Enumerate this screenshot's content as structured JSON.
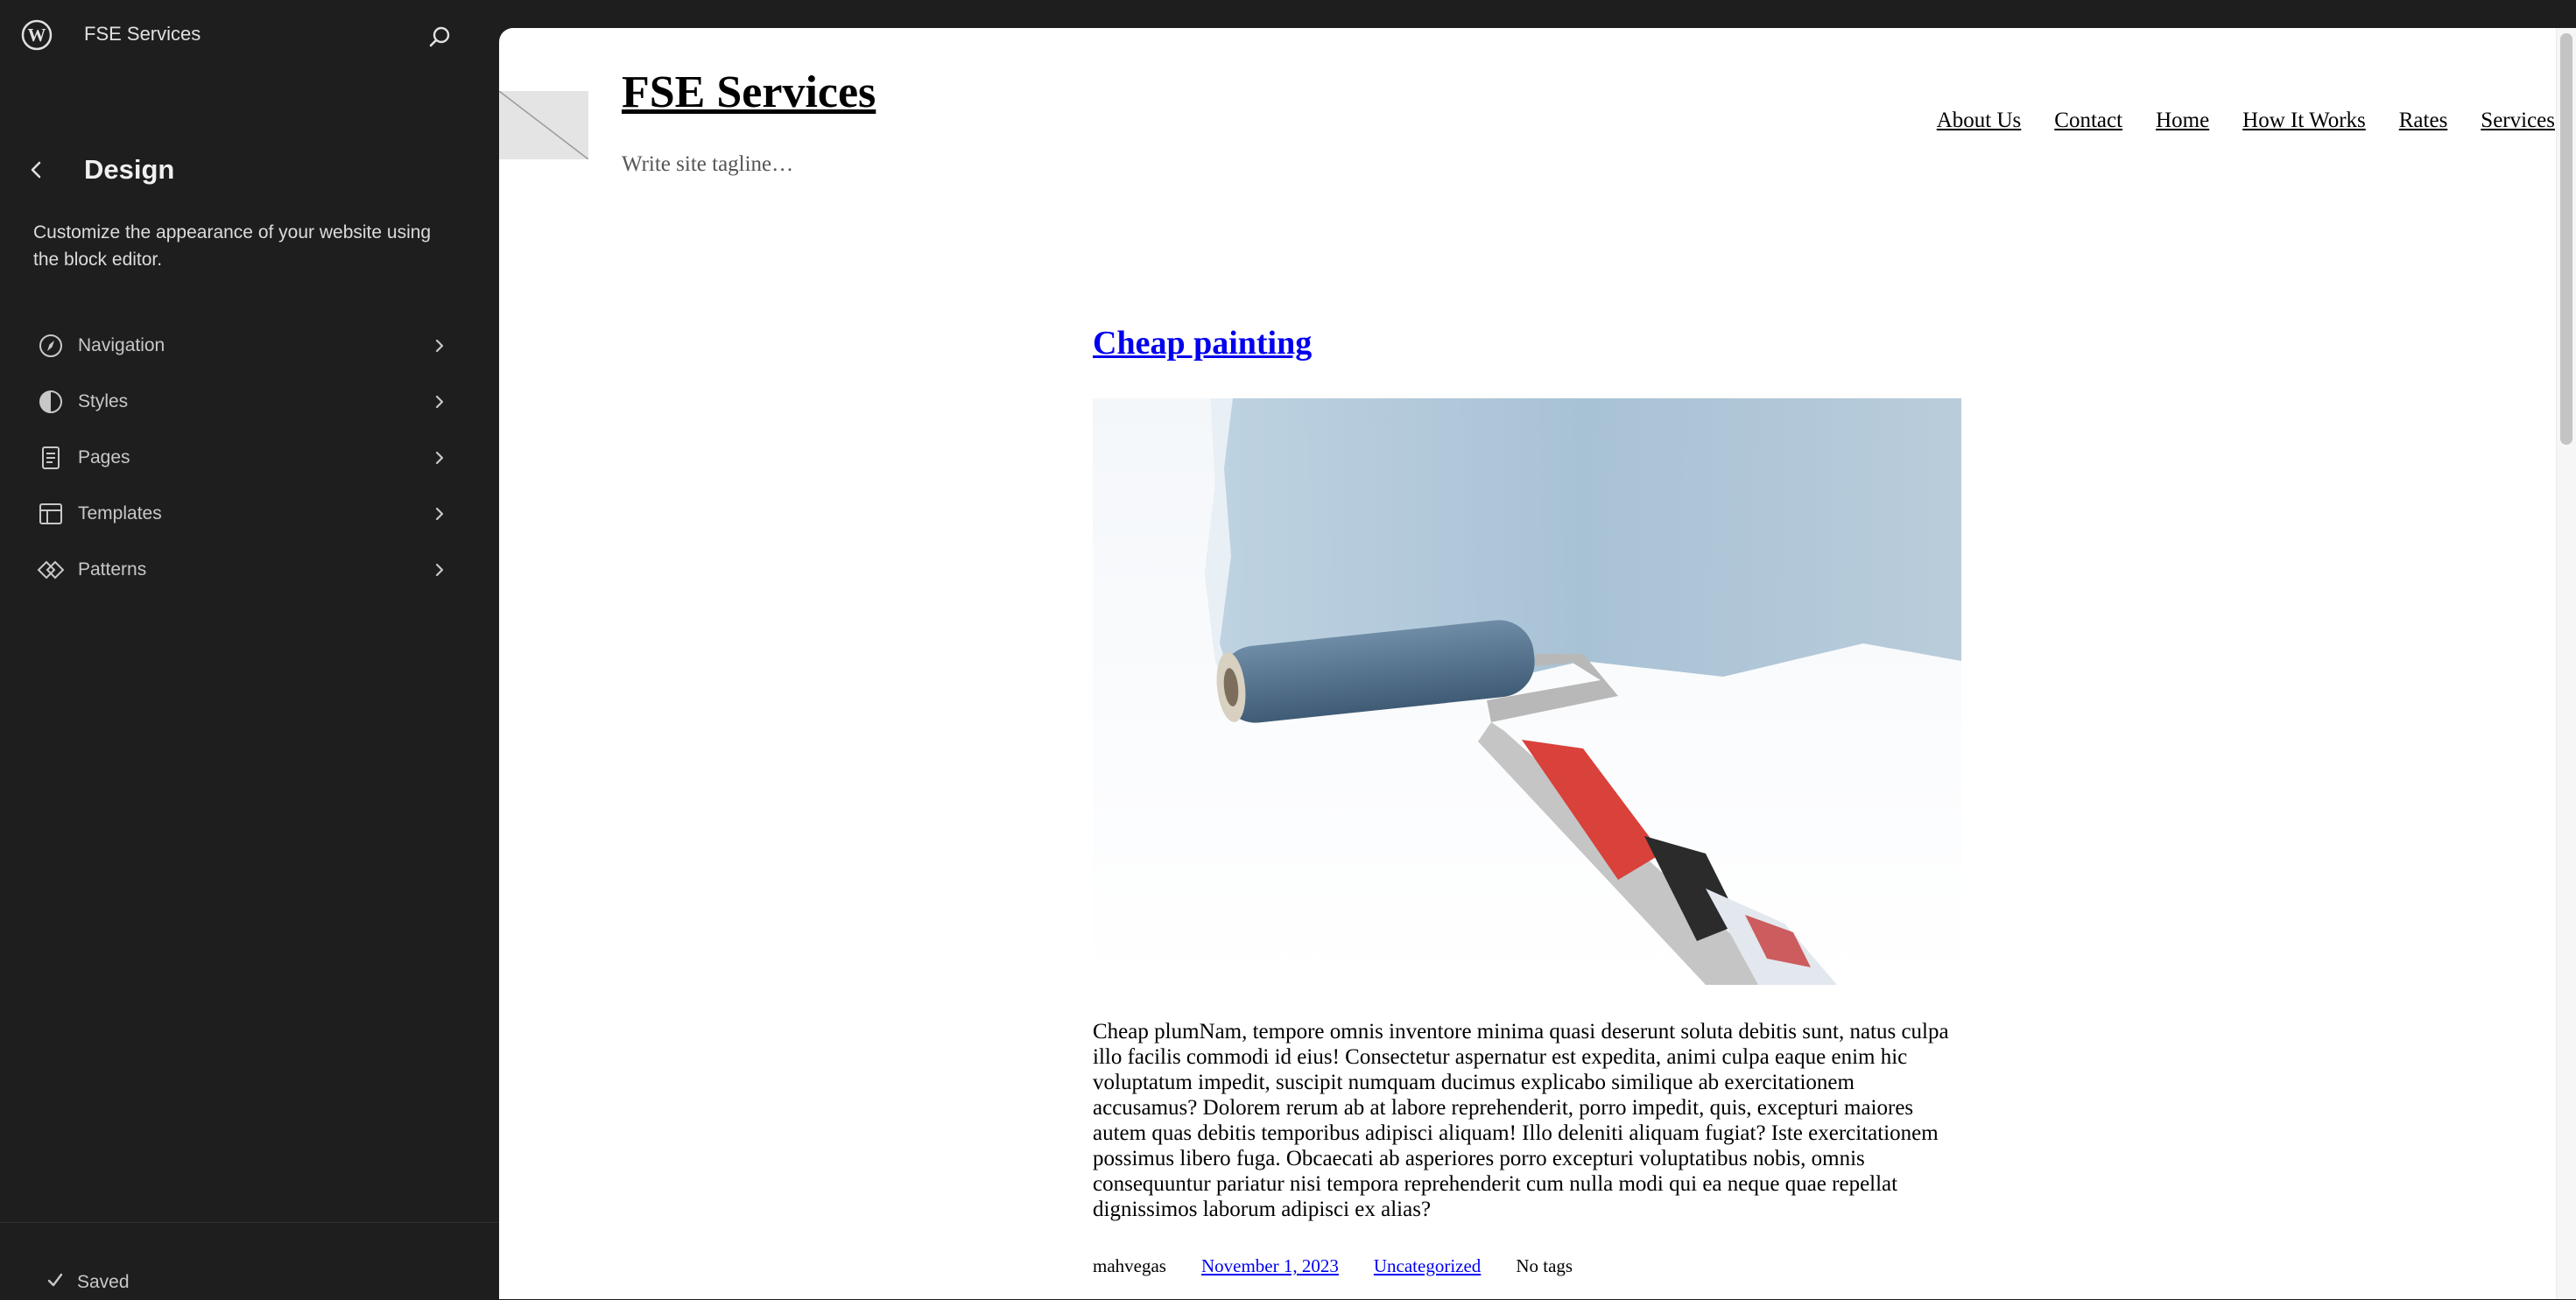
{
  "sidebar": {
    "site_name": "FSE Services",
    "panel_title": "Design",
    "panel_description": "Customize the appearance of your website using the block editor.",
    "items": [
      {
        "label": "Navigation",
        "icon": "navigation-icon"
      },
      {
        "label": "Styles",
        "icon": "styles-icon"
      },
      {
        "label": "Pages",
        "icon": "pages-icon"
      },
      {
        "label": "Templates",
        "icon": "templates-icon"
      },
      {
        "label": "Patterns",
        "icon": "patterns-icon"
      }
    ],
    "status": "Saved"
  },
  "preview": {
    "site_title": "FSE Services",
    "tagline": "Write site tagline…",
    "nav": [
      "About Us",
      "Contact",
      "Home",
      "How It Works",
      "Rates",
      "Services"
    ],
    "post": {
      "title": "Cheap painting",
      "excerpt": "Cheap plumNam, tempore omnis inventore minima quasi deserunt soluta debitis sunt, natus culpa illo facilis commodi id eius! Consectetur aspernatur est expedita, animi culpa eaque enim hic voluptatum impedit, suscipit numquam ducimus explicabo similique ab exercitationem accusamus? Dolorem rerum ab at labore reprehenderit, porro impedit, quis, excepturi maiores autem quas debitis temporibus adipisci aliquam! Illo deleniti aliquam fugiat? Iste exercitationem possimus libero fuga. Obcaecati ab asperiores porro excepturi voluptatibus nobis, omnis consequuntur pariatur nisi tempora reprehenderit cum nulla modi qui ea neque quae repellat dignissimos laborum adipisci ex alias?",
      "author": "mahvegas",
      "date": "November 1, 2023",
      "category": "Uncategorized",
      "tags": "No tags"
    }
  },
  "colors": {
    "sidebar_bg": "#1e1e1e",
    "link_blue": "#0000ee",
    "paint_blue": "#a9c3d6",
    "roller_red": "#d9413b"
  }
}
